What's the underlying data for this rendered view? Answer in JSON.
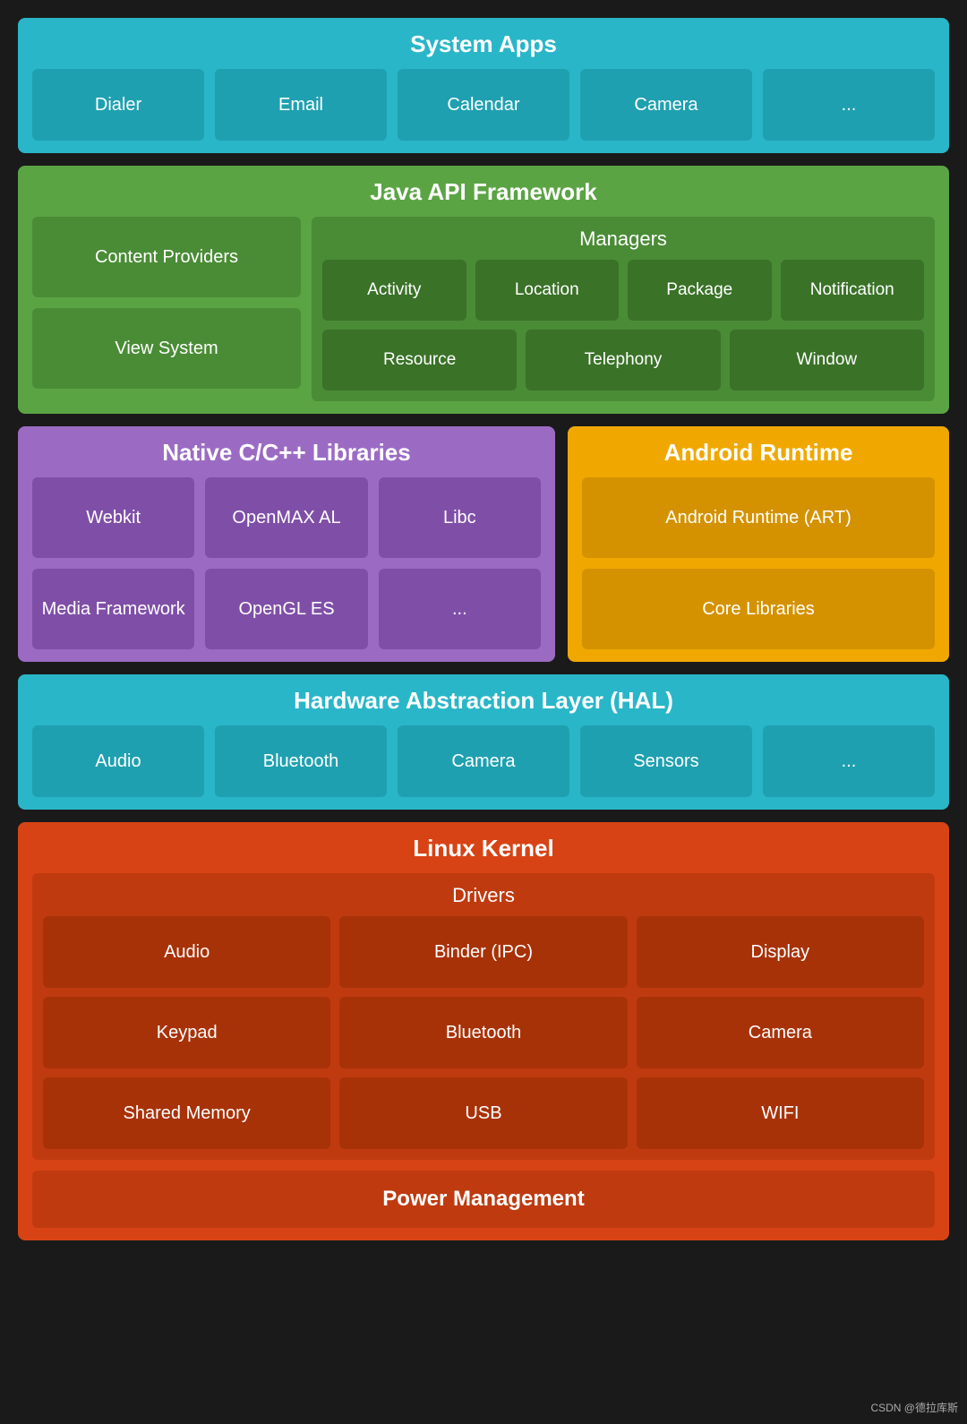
{
  "systemApps": {
    "title": "System Apps",
    "cells": [
      "Dialer",
      "Email",
      "Calendar",
      "Camera",
      "..."
    ]
  },
  "javaApi": {
    "title": "Java API Framework",
    "contentProviders": "Content Providers",
    "viewSystem": "View System",
    "managers": {
      "title": "Managers",
      "row1": [
        "Activity",
        "Location",
        "Package",
        "Notification"
      ],
      "row2": [
        "Resource",
        "Telephony",
        "Window"
      ]
    }
  },
  "nativeLibs": {
    "title": "Native C/C++ Libraries",
    "row1": [
      "Webkit",
      "OpenMAX AL",
      "Libc"
    ],
    "row2": [
      "Media Framework",
      "OpenGL ES",
      "..."
    ]
  },
  "androidRuntime": {
    "title": "Android Runtime",
    "cells": [
      "Android Runtime (ART)",
      "Core Libraries"
    ]
  },
  "hal": {
    "title": "Hardware Abstraction Layer (HAL)",
    "cells": [
      "Audio",
      "Bluetooth",
      "Camera",
      "Sensors",
      "..."
    ]
  },
  "linuxKernel": {
    "title": "Linux Kernel",
    "drivers": {
      "title": "Drivers",
      "row1": [
        "Audio",
        "Binder (IPC)",
        "Display"
      ],
      "row2": [
        "Keypad",
        "Bluetooth",
        "Camera"
      ],
      "row3": [
        "Shared Memory",
        "USB",
        "WIFI"
      ]
    },
    "powerManagement": "Power Management"
  },
  "watermark": "CSDN @德拉库斯"
}
